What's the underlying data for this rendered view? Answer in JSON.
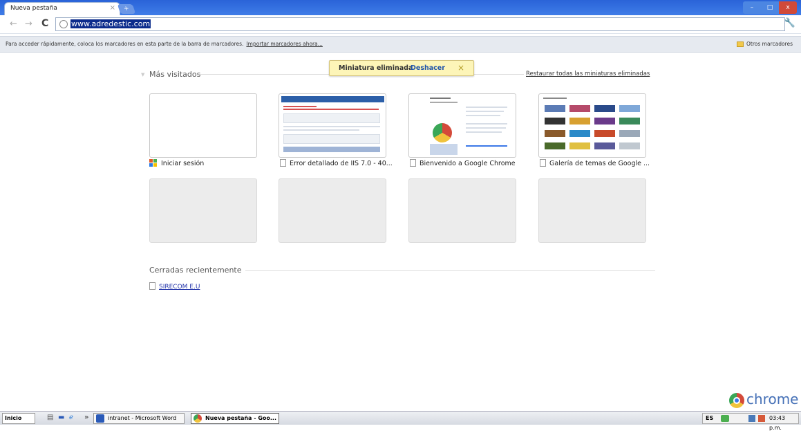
{
  "browser": {
    "tab_title": "Nueva pestaña",
    "tab_close": "×",
    "new_tab": "+",
    "window_minimize": "–",
    "window_maximize": "□",
    "window_close": "x",
    "back": "←",
    "forward": "→",
    "reload": "C",
    "url": "www.adredestic.com",
    "wrench": "🔧"
  },
  "bookmarks_bar": {
    "hint": "Para acceder rápidamente, coloca los marcadores en esta parte de la barra de marcadores.",
    "import_link": "Importar marcadores ahora...",
    "other_bookmarks": "Otros marcadores"
  },
  "notification": {
    "text": "Miniatura eliminada",
    "undo": "Deshacer",
    "close": "×"
  },
  "most_visited": {
    "title": "Más visitados",
    "restore_link": "Restaurar todas las miniaturas eliminadas",
    "tiles": [
      {
        "label": "Iniciar sesión"
      },
      {
        "label": "Error detallado de IIS 7.0 - 40..."
      },
      {
        "label": "Bienvenido a Google Chrome"
      },
      {
        "label": "Galería de temas de Google ..."
      }
    ]
  },
  "recently_closed": {
    "title": "Cerradas recientemente",
    "items": [
      {
        "label": "SIRECOM E.U"
      }
    ]
  },
  "brand": {
    "wordmark": "chrome"
  },
  "taskbar": {
    "start": "Inicio",
    "more": "»",
    "tasks": [
      {
        "label": "intranet - Microsoft Word"
      },
      {
        "label": "Nueva pestaña - Goo..."
      }
    ],
    "language": "ES",
    "clock": "03:43 p.m."
  },
  "colors": {
    "titlebar": "#3f7de8",
    "notification_bg": "#fdf5b8",
    "link": "#2233aa"
  }
}
